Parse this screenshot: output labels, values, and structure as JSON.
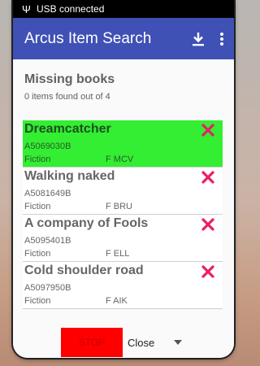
{
  "status_bar": {
    "text": "USB connected",
    "icon": "usb-icon"
  },
  "app_bar": {
    "title": "Arcus Item Search",
    "actions": [
      "download-icon",
      "more-vert-icon"
    ]
  },
  "colors": {
    "app_bar": "#3f51b5",
    "selected_item": "#33ee33",
    "remove_icon": "#e91e63",
    "stop_button": "#ff0000"
  },
  "main": {
    "heading": "Missing books",
    "subheading": "0 items found out of 4",
    "items": [
      {
        "title": "Dreamcatcher",
        "barcode": "A5069030B",
        "genre": "Fiction",
        "shelf": "F MCV",
        "selected": true
      },
      {
        "title": "Walking naked",
        "barcode": "A5081649B",
        "genre": "Fiction",
        "shelf": "F BRU",
        "selected": false
      },
      {
        "title": "A company of Fools",
        "barcode": "A5095401B",
        "genre": "Fiction",
        "shelf": "F ELL",
        "selected": false
      },
      {
        "title": "Cold shoulder road",
        "barcode": "A5097950B",
        "genre": "Fiction",
        "shelf": "F AIK",
        "selected": false
      }
    ]
  },
  "footer": {
    "stop_label": "STOP",
    "close_selected": "Close"
  }
}
